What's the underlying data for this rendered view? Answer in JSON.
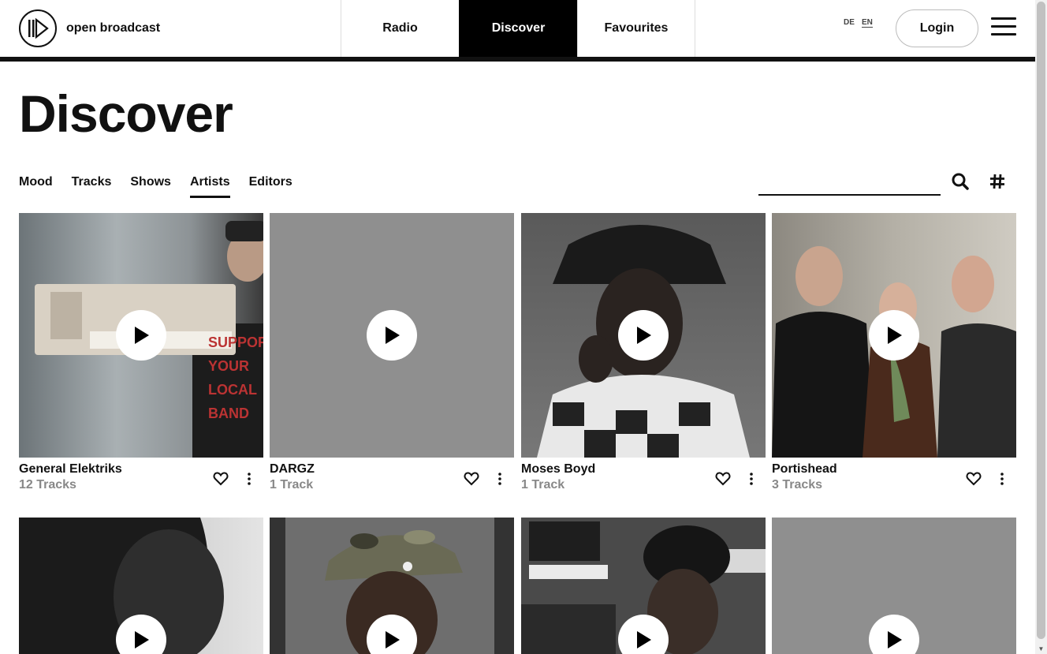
{
  "header": {
    "logo_text": "open broadcast",
    "nav": [
      {
        "label": "Radio"
      },
      {
        "label": "Discover"
      },
      {
        "label": "Favourites"
      }
    ],
    "lang": {
      "de": "DE",
      "en": "EN"
    },
    "login_label": "Login"
  },
  "page": {
    "title": "Discover",
    "tabs": [
      "Mood",
      "Tracks",
      "Shows",
      "Artists",
      "Editors"
    ],
    "active_tab": "Artists",
    "search_value": ""
  },
  "artists": [
    {
      "name": "General Elektriks",
      "count": "12 Tracks"
    },
    {
      "name": "DARGZ",
      "count": "1 Track"
    },
    {
      "name": "Moses Boyd",
      "count": "1 Track"
    },
    {
      "name": "Portishead",
      "count": "3 Tracks"
    }
  ],
  "colors": {
    "accent": "#000000",
    "muted_text": "#888888",
    "placeholder_bg": "#8f8f8f"
  }
}
